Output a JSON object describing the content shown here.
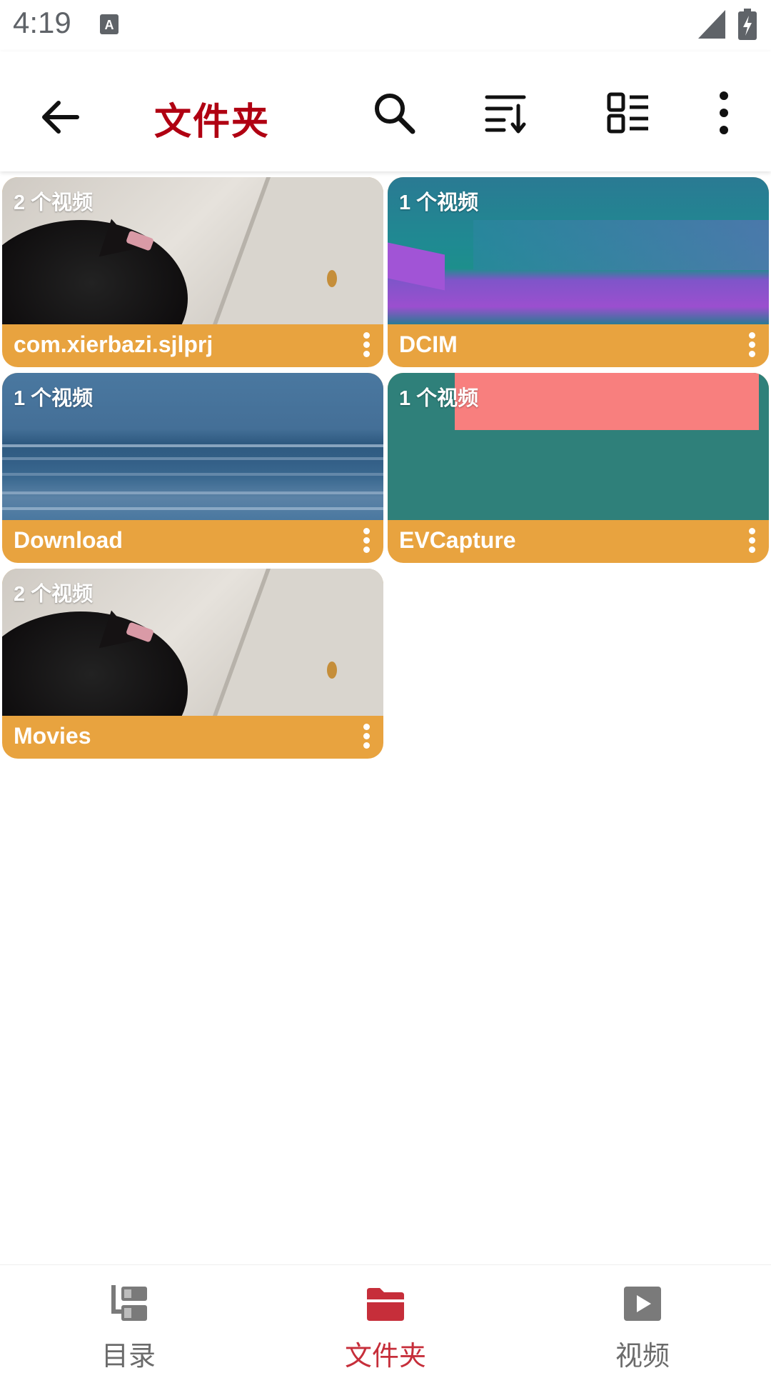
{
  "status_bar": {
    "time": "4:19"
  },
  "app_bar": {
    "title": "文件夹"
  },
  "folders": [
    {
      "name": "com.xierbazi.sjlprj",
      "count": "2 个视频"
    },
    {
      "name": "DCIM",
      "count": "1 个视频"
    },
    {
      "name": "Download",
      "count": "1 个视频"
    },
    {
      "name": "EVCapture",
      "count": "1 个视频"
    },
    {
      "name": "Movies",
      "count": "2 个视频"
    }
  ],
  "bottom_nav": {
    "items": [
      {
        "label": "目录",
        "active": false
      },
      {
        "label": "文件夹",
        "active": true
      },
      {
        "label": "视频",
        "active": false
      }
    ]
  },
  "colors": {
    "accent": "#b00012",
    "nav_active": "#c62e3a",
    "card_label_bg": "#e8a33f",
    "icon_gray": "#5f6368"
  }
}
